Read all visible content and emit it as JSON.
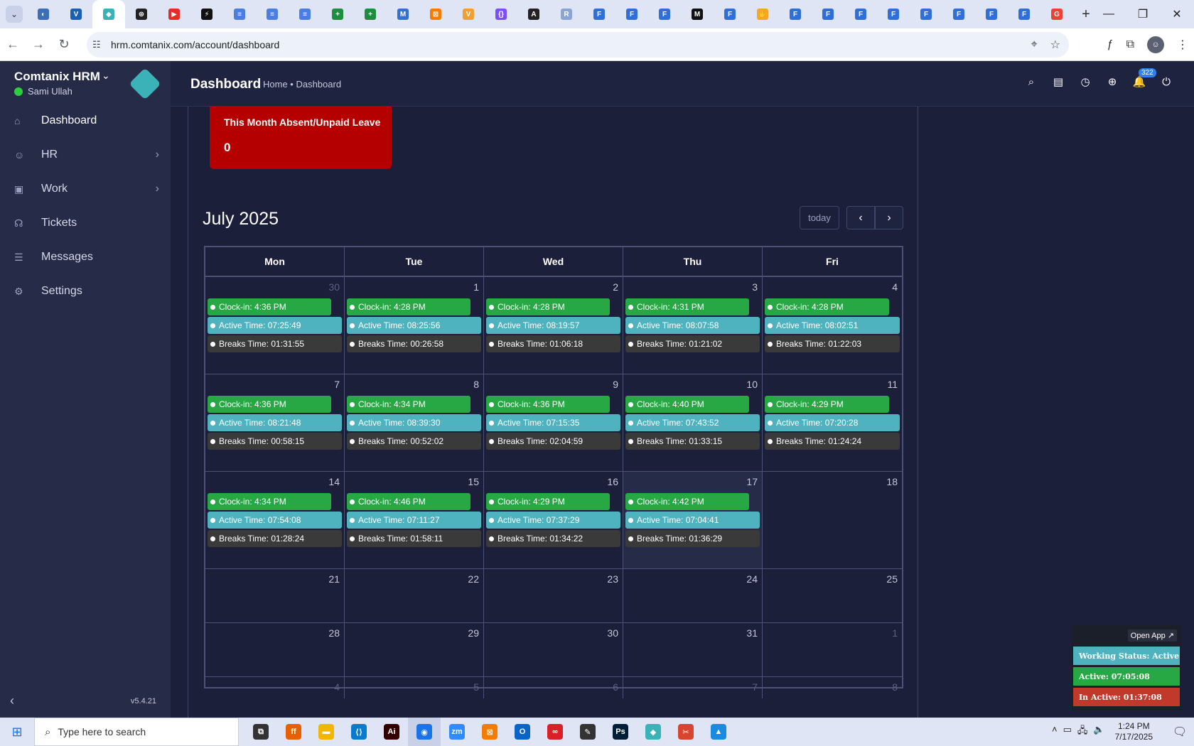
{
  "browser": {
    "url": "hrm.comtanix.com/account/dashboard",
    "tabs": [
      {
        "icon": "globe-icon",
        "color": "#3b6fb6",
        "glyph": "◐"
      },
      {
        "icon": "vpn-icon",
        "color": "#1a5fb4",
        "glyph": "V"
      },
      {
        "icon": "comtanix-icon",
        "color": "#3bb2b8",
        "glyph": "◆",
        "active": true
      },
      {
        "icon": "openai-icon",
        "color": "#222222",
        "glyph": "⊛"
      },
      {
        "icon": "youtube-icon",
        "color": "#e52d27",
        "glyph": "▶"
      },
      {
        "icon": "bolt-icon",
        "color": "#111111",
        "glyph": "⚡"
      },
      {
        "icon": "docs-icon",
        "color": "#4a7fe0",
        "glyph": "≡"
      },
      {
        "icon": "docs-icon",
        "color": "#4a7fe0",
        "glyph": "≡"
      },
      {
        "icon": "docs-icon",
        "color": "#4a7fe0",
        "glyph": "≡"
      },
      {
        "icon": "sheets-icon",
        "color": "#1e8e3e",
        "glyph": "+"
      },
      {
        "icon": "sheets-icon",
        "color": "#1e8e3e",
        "glyph": "+"
      },
      {
        "icon": "myapp-icon",
        "color": "#3370d0",
        "glyph": "M"
      },
      {
        "icon": "xampp-icon",
        "color": "#f57c00",
        "glyph": "⊠"
      },
      {
        "icon": "vue-icon",
        "color": "#f0a030",
        "glyph": "V"
      },
      {
        "icon": "braces-icon",
        "color": "#7c4dff",
        "glyph": "{}"
      },
      {
        "icon": "laravel-icon",
        "color": "#222222",
        "glyph": "A"
      },
      {
        "icon": "repo-icon",
        "color": "#8aa4d6",
        "glyph": "R"
      },
      {
        "icon": "forms-icon",
        "color": "#2f6fd6",
        "glyph": "F"
      },
      {
        "icon": "forms-icon",
        "color": "#2f6fd6",
        "glyph": "F"
      },
      {
        "icon": "forms-icon",
        "color": "#2f6fd6",
        "glyph": "F"
      },
      {
        "icon": "medium-icon",
        "color": "#111111",
        "glyph": "M"
      },
      {
        "icon": "forms-icon",
        "color": "#2f6fd6",
        "glyph": "F"
      },
      {
        "icon": "hand-icon",
        "color": "#f5a623",
        "glyph": "✋"
      },
      {
        "icon": "forms-icon",
        "color": "#2f6fd6",
        "glyph": "F"
      },
      {
        "icon": "forms-icon",
        "color": "#2f6fd6",
        "glyph": "F"
      },
      {
        "icon": "forms-icon",
        "color": "#2f6fd6",
        "glyph": "F"
      },
      {
        "icon": "forms-icon",
        "color": "#2f6fd6",
        "glyph": "F"
      },
      {
        "icon": "forms-icon",
        "color": "#2f6fd6",
        "glyph": "F"
      },
      {
        "icon": "forms-icon",
        "color": "#2f6fd6",
        "glyph": "F"
      },
      {
        "icon": "forms-icon",
        "color": "#2f6fd6",
        "glyph": "F"
      },
      {
        "icon": "forms-icon",
        "color": "#2f6fd6",
        "glyph": "F"
      },
      {
        "icon": "google-icon",
        "color": "#ea4335",
        "glyph": "G"
      }
    ]
  },
  "sidebar": {
    "brand": "Comtanix HRM",
    "user": "Sami Ullah",
    "version": "v5.4.21",
    "items": [
      {
        "label": "Dashboard",
        "icon": "home-icon",
        "glyph": "⌂",
        "chevron": false,
        "active": true
      },
      {
        "label": "HR",
        "icon": "users-icon",
        "glyph": "☺",
        "chevron": true,
        "active": false
      },
      {
        "label": "Work",
        "icon": "briefcase-icon",
        "glyph": "▣",
        "chevron": true,
        "active": false
      },
      {
        "label": "Tickets",
        "icon": "headset-icon",
        "glyph": "☊",
        "chevron": false,
        "active": false
      },
      {
        "label": "Messages",
        "icon": "message-icon",
        "glyph": "☰",
        "chevron": false,
        "active": false
      },
      {
        "label": "Settings",
        "icon": "gear-icon",
        "glyph": "⚙",
        "chevron": false,
        "active": false
      }
    ]
  },
  "header": {
    "title": "Dashboard",
    "breadcrumb": "Home • Dashboard",
    "notifications": "322"
  },
  "stat_card": {
    "label": "This Month Absent/Unpaid Leave",
    "value": "0",
    "color": "#b50000"
  },
  "calendar": {
    "title": "July 2025",
    "today_label": "today",
    "days": [
      "Mon",
      "Tue",
      "Wed",
      "Thu",
      "Fri"
    ],
    "event_labels": {
      "clock": "Clock-in: ",
      "active": "Active Time: ",
      "break": "Breaks Time: "
    },
    "colors": {
      "clock": "#28a745",
      "active": "#4fb3bf",
      "break": "#3a3a3a"
    },
    "weeks": [
      [
        {
          "date": "30",
          "muted": true,
          "clock": "4:36 PM",
          "active": "07:25:49",
          "break": "01:31:55"
        },
        {
          "date": "1",
          "clock": "4:28 PM",
          "active": "08:25:56",
          "break": "00:26:58"
        },
        {
          "date": "2",
          "clock": "4:28 PM",
          "active": "08:19:57",
          "break": "01:06:18"
        },
        {
          "date": "3",
          "clock": "4:31 PM",
          "active": "08:07:58",
          "break": "01:21:02"
        },
        {
          "date": "4",
          "clock": "4:28 PM",
          "active": "08:02:51",
          "break": "01:22:03"
        }
      ],
      [
        {
          "date": "7",
          "clock": "4:36 PM",
          "active": "08:21:48",
          "break": "00:58:15"
        },
        {
          "date": "8",
          "clock": "4:34 PM",
          "active": "08:39:30",
          "break": "00:52:02"
        },
        {
          "date": "9",
          "clock": "4:36 PM",
          "active": "07:15:35",
          "break": "02:04:59"
        },
        {
          "date": "10",
          "clock": "4:40 PM",
          "active": "07:43:52",
          "break": "01:33:15"
        },
        {
          "date": "11",
          "clock": "4:29 PM",
          "active": "07:20:28",
          "break": "01:24:24"
        }
      ],
      [
        {
          "date": "14",
          "clock": "4:34 PM",
          "active": "07:54:08",
          "break": "01:28:24"
        },
        {
          "date": "15",
          "clock": "4:46 PM",
          "active": "07:11:27",
          "break": "01:58:11"
        },
        {
          "date": "16",
          "clock": "4:29 PM",
          "active": "07:37:29",
          "break": "01:34:22"
        },
        {
          "date": "17",
          "today": true,
          "clock": "4:42 PM",
          "active": "07:04:41",
          "break": "01:36:29"
        },
        {
          "date": "18"
        }
      ],
      [
        {
          "date": "21"
        },
        {
          "date": "22"
        },
        {
          "date": "23"
        },
        {
          "date": "24"
        },
        {
          "date": "25"
        }
      ],
      [
        {
          "date": "28"
        },
        {
          "date": "29"
        },
        {
          "date": "30"
        },
        {
          "date": "31"
        },
        {
          "date": "1",
          "muted": true
        }
      ],
      [
        {
          "date": "4",
          "muted": true
        },
        {
          "date": "5",
          "muted": true
        },
        {
          "date": "6",
          "muted": true
        },
        {
          "date": "7",
          "muted": true
        },
        {
          "date": "8",
          "muted": true
        }
      ]
    ]
  },
  "status_widget": {
    "open_app": "Open App ↗",
    "working_status": "Working Status: Active",
    "active": "Active: 07:05:08",
    "inactive": "In Active: 01:37:08"
  },
  "taskbar": {
    "search_placeholder": "Type here to search",
    "time": "1:24 PM",
    "date": "7/17/2025",
    "apps": [
      {
        "icon": "task-view-icon",
        "color": "#333333",
        "glyph": "⧉"
      },
      {
        "icon": "firefox-icon",
        "color": "#e66000",
        "glyph": "ff"
      },
      {
        "icon": "file-explorer-icon",
        "color": "#f2b600",
        "glyph": "▬"
      },
      {
        "icon": "vscode-icon",
        "color": "#0a7acc",
        "glyph": "⟨⟩"
      },
      {
        "icon": "illustrator-icon",
        "color": "#330000",
        "glyph": "Ai"
      },
      {
        "icon": "chrome-icon",
        "color": "#1a73e8",
        "glyph": "◉",
        "active": true
      },
      {
        "icon": "zoom-icon",
        "color": "#2d8cff",
        "glyph": "zm"
      },
      {
        "icon": "xampp-icon",
        "color": "#f57c00",
        "glyph": "⊠"
      },
      {
        "icon": "outlook-icon",
        "color": "#0a64c8",
        "glyph": "O"
      },
      {
        "icon": "creative-cloud-icon",
        "color": "#da1f26",
        "glyph": "∞"
      },
      {
        "icon": "pen-icon",
        "color": "#333333",
        "glyph": "✎"
      },
      {
        "icon": "photoshop-icon",
        "color": "#001e36",
        "glyph": "Ps"
      },
      {
        "icon": "comtanix-icon",
        "color": "#3bb2b8",
        "glyph": "◆"
      },
      {
        "icon": "scissors-icon",
        "color": "#d9442e",
        "glyph": "✂"
      },
      {
        "icon": "photos-icon",
        "color": "#1a8be0",
        "glyph": "▲"
      }
    ]
  }
}
